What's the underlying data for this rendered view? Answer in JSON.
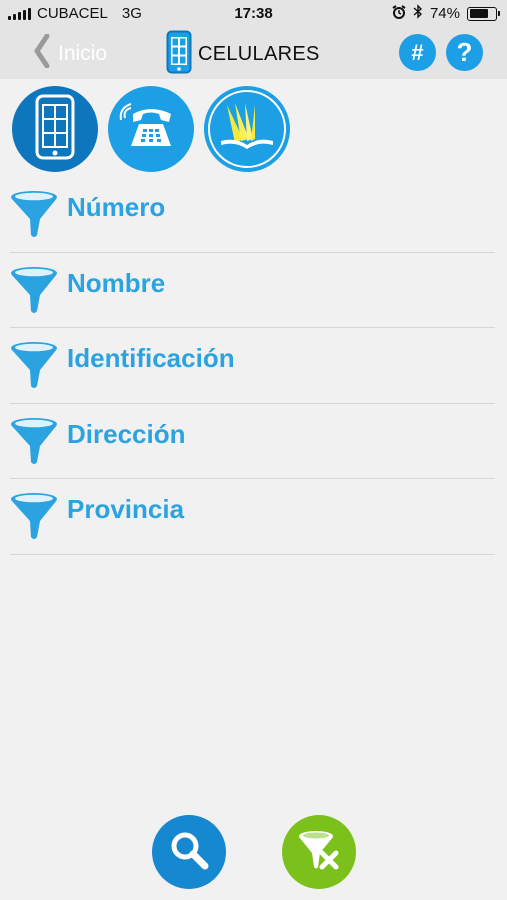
{
  "status_bar": {
    "carrier": "CUBACEL",
    "network": "3G",
    "time": "17:38",
    "battery": "74%",
    "battery_level": 0.74,
    "icons": [
      "signal-bars-icon",
      "alarm-icon",
      "bluetooth-icon",
      "battery-icon"
    ]
  },
  "nav": {
    "back_label": "Inicio",
    "title": "CELULARES",
    "hash_label": "#",
    "help_label": "?",
    "icons": [
      "back-chevron-icon",
      "mobile-phone-icon"
    ]
  },
  "categories": [
    {
      "name": "mobile",
      "icon": "mobile-phone-icon",
      "selected": true
    },
    {
      "name": "landline",
      "icon": "telephone-icon",
      "selected": false
    },
    {
      "name": "directory",
      "icon": "book-icon",
      "selected": false
    }
  ],
  "filters": [
    {
      "label": "Número"
    },
    {
      "label": "Nombre"
    },
    {
      "label": "Identificación"
    },
    {
      "label": "Dirección"
    },
    {
      "label": "Provincia"
    }
  ],
  "bottom_actions": [
    {
      "name": "search",
      "icon": "magnifier-icon"
    },
    {
      "name": "clear-filters",
      "icon": "funnel-clear-icon"
    }
  ],
  "colors": {
    "accent": "#1c9fe5",
    "accent_dark": "#0e76bd",
    "filter_text": "#2aa3e0",
    "clear_button": "#7cc11b",
    "background": "#f1f1f1",
    "bar": "#e4e4e4"
  }
}
